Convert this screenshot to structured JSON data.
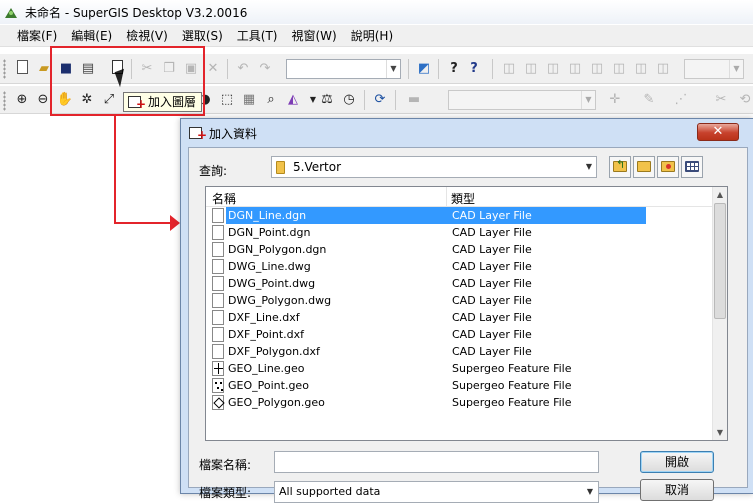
{
  "window": {
    "title": "未命名 - SuperGIS Desktop V3.2.0016"
  },
  "menubar": {
    "items": [
      "檔案(F)",
      "編輯(E)",
      "檢視(V)",
      "選取(S)",
      "工具(T)",
      "視窗(W)",
      "說明(H)"
    ]
  },
  "tooltip": {
    "label": "加入圖層"
  },
  "dialog": {
    "title": "加入資料",
    "close_glyph": "✕",
    "look_in_label": "查詢:",
    "look_in_value": "5.Vertor",
    "columns": {
      "name": "名稱",
      "type": "類型"
    },
    "files": [
      {
        "name": "DGN_Line.dgn",
        "type": "CAD Layer File",
        "icon": "cad-file-icon",
        "selected": true
      },
      {
        "name": "DGN_Point.dgn",
        "type": "CAD Layer File",
        "icon": "cad-file-icon"
      },
      {
        "name": "DGN_Polygon.dgn",
        "type": "CAD Layer File",
        "icon": "cad-file-icon"
      },
      {
        "name": "DWG_Line.dwg",
        "type": "CAD Layer File",
        "icon": "cad-file-icon"
      },
      {
        "name": "DWG_Point.dwg",
        "type": "CAD Layer File",
        "icon": "cad-file-icon"
      },
      {
        "name": "DWG_Polygon.dwg",
        "type": "CAD Layer File",
        "icon": "cad-file-icon"
      },
      {
        "name": "DXF_Line.dxf",
        "type": "CAD Layer File",
        "icon": "cad-file-icon"
      },
      {
        "name": "DXF_Point.dxf",
        "type": "CAD Layer File",
        "icon": "cad-file-icon"
      },
      {
        "name": "DXF_Polygon.dxf",
        "type": "CAD Layer File",
        "icon": "cad-file-icon"
      },
      {
        "name": "GEO_Line.geo",
        "type": "Supergeo Feature File",
        "icon": "line-layer-icon"
      },
      {
        "name": "GEO_Point.geo",
        "type": "Supergeo Feature File",
        "icon": "point-layer-icon"
      },
      {
        "name": "GEO_Polygon.geo",
        "type": "Supergeo Feature File",
        "icon": "polygon-layer-icon"
      }
    ],
    "file_name_label": "檔案名稱:",
    "file_name_value": "",
    "file_type_label": "檔案類型:",
    "file_type_value": "All supported data",
    "open_label": "開啟",
    "cancel_label": "取消"
  },
  "colors": {
    "callout": "#e3242b",
    "selection": "#3399ff",
    "dialog_frame": "#cfe0f5",
    "close_button": "#c7412c"
  }
}
